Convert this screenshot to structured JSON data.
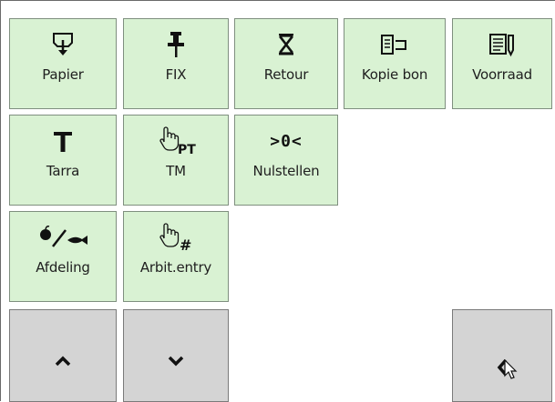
{
  "buttons": {
    "papier": {
      "label": "Papier",
      "icon": "paper-feed-icon"
    },
    "fix": {
      "label": "FIX",
      "icon": "pushpin-icon"
    },
    "retour": {
      "label": "Retour",
      "icon": "return-icon"
    },
    "kopie_bon": {
      "label": "Kopie bon",
      "icon": "copy-receipt-icon"
    },
    "voorraad": {
      "label": "Voorraad",
      "icon": "stock-icon"
    },
    "tarra": {
      "label": "Tarra",
      "icon": "tare-icon"
    },
    "tm": {
      "label": "TM",
      "icon": "touch-pt-icon",
      "icon_text": "PT"
    },
    "nulstellen": {
      "label": "Nulstellen",
      "icon": "zero-icon",
      "icon_text": ">0<"
    },
    "afdeling": {
      "label": "Afdeling",
      "icon": "department-icon"
    },
    "arbit_entry": {
      "label": "Arbit.entry",
      "icon": "touch-hash-icon",
      "icon_text": "#"
    },
    "scroll_up": {
      "icon": "chevron-up-icon"
    },
    "scroll_down": {
      "icon": "chevron-down-icon"
    },
    "back": {
      "icon": "chevron-left-icon"
    }
  },
  "colors": {
    "button_green": "#d9f2d3",
    "button_gray": "#d4d4d4"
  }
}
